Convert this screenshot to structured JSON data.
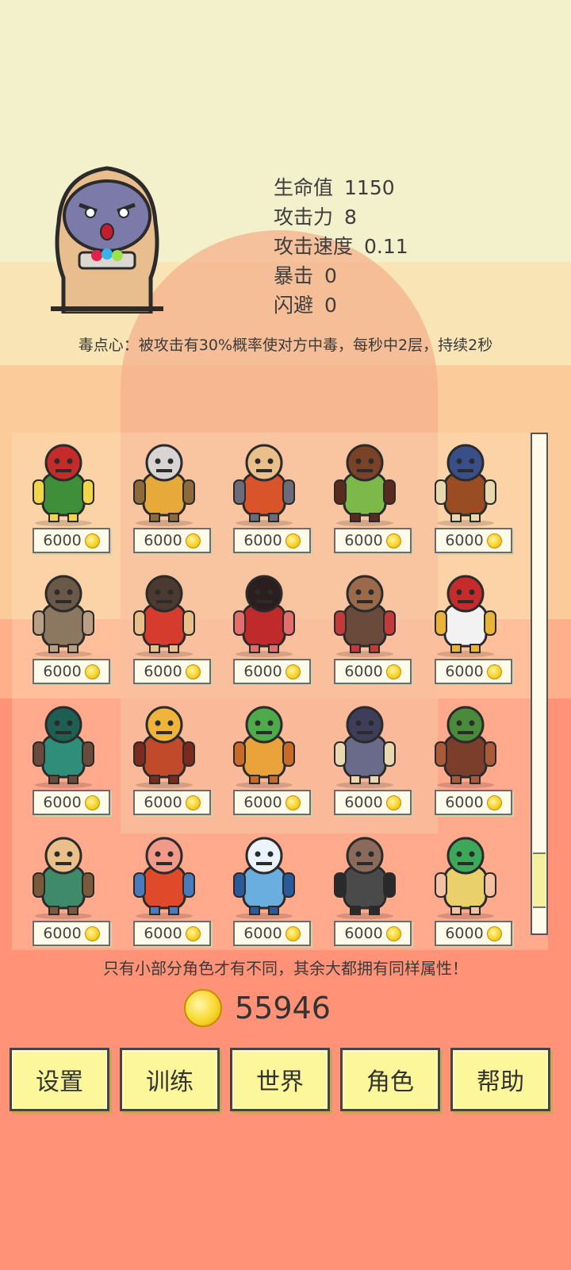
{
  "hero": {
    "stats": [
      {
        "label": "生命值",
        "value": "1150"
      },
      {
        "label": "攻击力",
        "value": "8"
      },
      {
        "label": "攻击速度",
        "value": "0.11"
      },
      {
        "label": "暴击",
        "value": "0"
      },
      {
        "label": "闪避",
        "value": "0"
      }
    ],
    "ability": "毒点心：被攻击有30%概率使对方中毒，每秒中2层，持续2秒"
  },
  "characters": [
    {
      "icon": "frog-king-icon",
      "price": "6000"
    },
    {
      "icon": "armored-dog-knight-icon",
      "price": "6000"
    },
    {
      "icon": "red-dragon-warrior-icon",
      "price": "6000"
    },
    {
      "icon": "goblin-boar-rider-icon",
      "price": "6000"
    },
    {
      "icon": "minotaur-icon",
      "price": "6000"
    },
    {
      "icon": "rock-golem-icon",
      "price": "6000"
    },
    {
      "icon": "crocodile-spearman-icon",
      "price": "6000"
    },
    {
      "icon": "red-demon-girl-icon",
      "price": "6000"
    },
    {
      "icon": "lizard-beast-icon",
      "price": "6000"
    },
    {
      "icon": "chicken-brawler-icon",
      "price": "6000"
    },
    {
      "icon": "green-troll-icon",
      "price": "6000"
    },
    {
      "icon": "mimic-chest-icon",
      "price": "6000"
    },
    {
      "icon": "chimera-icon",
      "price": "6000"
    },
    {
      "icon": "tentacle-monster-icon",
      "price": "6000"
    },
    {
      "icon": "treant-icon",
      "price": "6000"
    },
    {
      "icon": "fish-warrior-icon",
      "price": "6000"
    },
    {
      "icon": "fox-cook-icon",
      "price": "6000"
    },
    {
      "icon": "shark-icon",
      "price": "6000"
    },
    {
      "icon": "hermit-crab-brute-icon",
      "price": "6000"
    },
    {
      "icon": "mermaid-icon",
      "price": "6000"
    }
  ],
  "hint": "只有小部分角色才有不同，其余大都拥有同样属性！",
  "coins": "55946",
  "menu": [
    "设置",
    "训练",
    "世界",
    "角色",
    "帮助"
  ],
  "colors": {
    "background_top": "#F3F0CC",
    "background_bottom": "#FF9277",
    "button_fill": "#FBF79A",
    "coin": "#F6D22C"
  },
  "scroll_position": 0.87
}
